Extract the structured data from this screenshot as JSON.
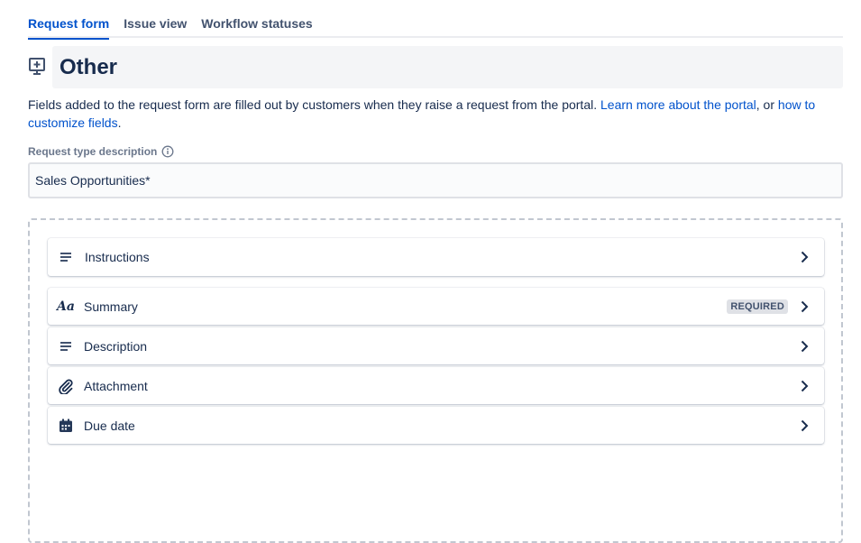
{
  "tabs": [
    {
      "label": "Request form",
      "active": true
    },
    {
      "label": "Issue view",
      "active": false
    },
    {
      "label": "Workflow statuses",
      "active": false
    }
  ],
  "page": {
    "title": "Other",
    "icon": "monitor-plus-icon"
  },
  "description": {
    "text_before": "Fields added to the request form are filled out by customers when they raise a request from the portal. ",
    "link1": "Learn more about the portal",
    "text_middle": ", or ",
    "link2": "how to customize fields",
    "text_after": "."
  },
  "request_type": {
    "label": "Request type description",
    "info_icon": "info-icon",
    "value": "Sales Opportunities*"
  },
  "fields": [
    {
      "name": "Instructions",
      "icon": "text-lines-icon",
      "badge": ""
    },
    {
      "name": "Summary",
      "icon": "text-aa-icon",
      "badge": "REQUIRED"
    },
    {
      "name": "Description",
      "icon": "text-lines-icon",
      "badge": ""
    },
    {
      "name": "Attachment",
      "icon": "paperclip-icon",
      "badge": ""
    },
    {
      "name": "Due date",
      "icon": "calendar-icon",
      "badge": ""
    }
  ],
  "colors": {
    "accent": "#0052cc",
    "text": "#172b4d",
    "muted": "#6b778c"
  }
}
